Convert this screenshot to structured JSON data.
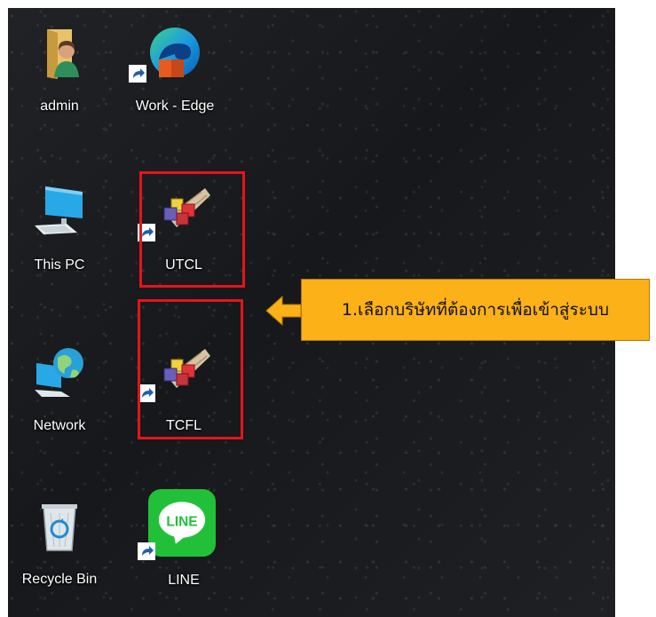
{
  "desktop": {
    "icons": {
      "admin": {
        "label": "admin",
        "icon": "user-folder-icon"
      },
      "edge": {
        "label": "Work - Edge",
        "icon": "edge-browser-icon"
      },
      "thispc": {
        "label": "This PC",
        "icon": "computer-monitor-icon"
      },
      "utcl": {
        "label": "UTCL",
        "icon": "blocks-app-icon"
      },
      "network": {
        "label": "Network",
        "icon": "network-globe-icon"
      },
      "tcfl": {
        "label": "TCFL",
        "icon": "blocks-app-icon"
      },
      "recycle": {
        "label": "Recycle Bin",
        "icon": "recycle-bin-icon"
      },
      "line": {
        "label": "LINE",
        "icon": "line-app-icon"
      }
    }
  },
  "annotation": {
    "text": "1.เลือกบริษัทที่ต้องการเพื่อเข้าสู่ระบบ",
    "callout_color": "#fbb117",
    "highlight_color": "#e4151b"
  }
}
